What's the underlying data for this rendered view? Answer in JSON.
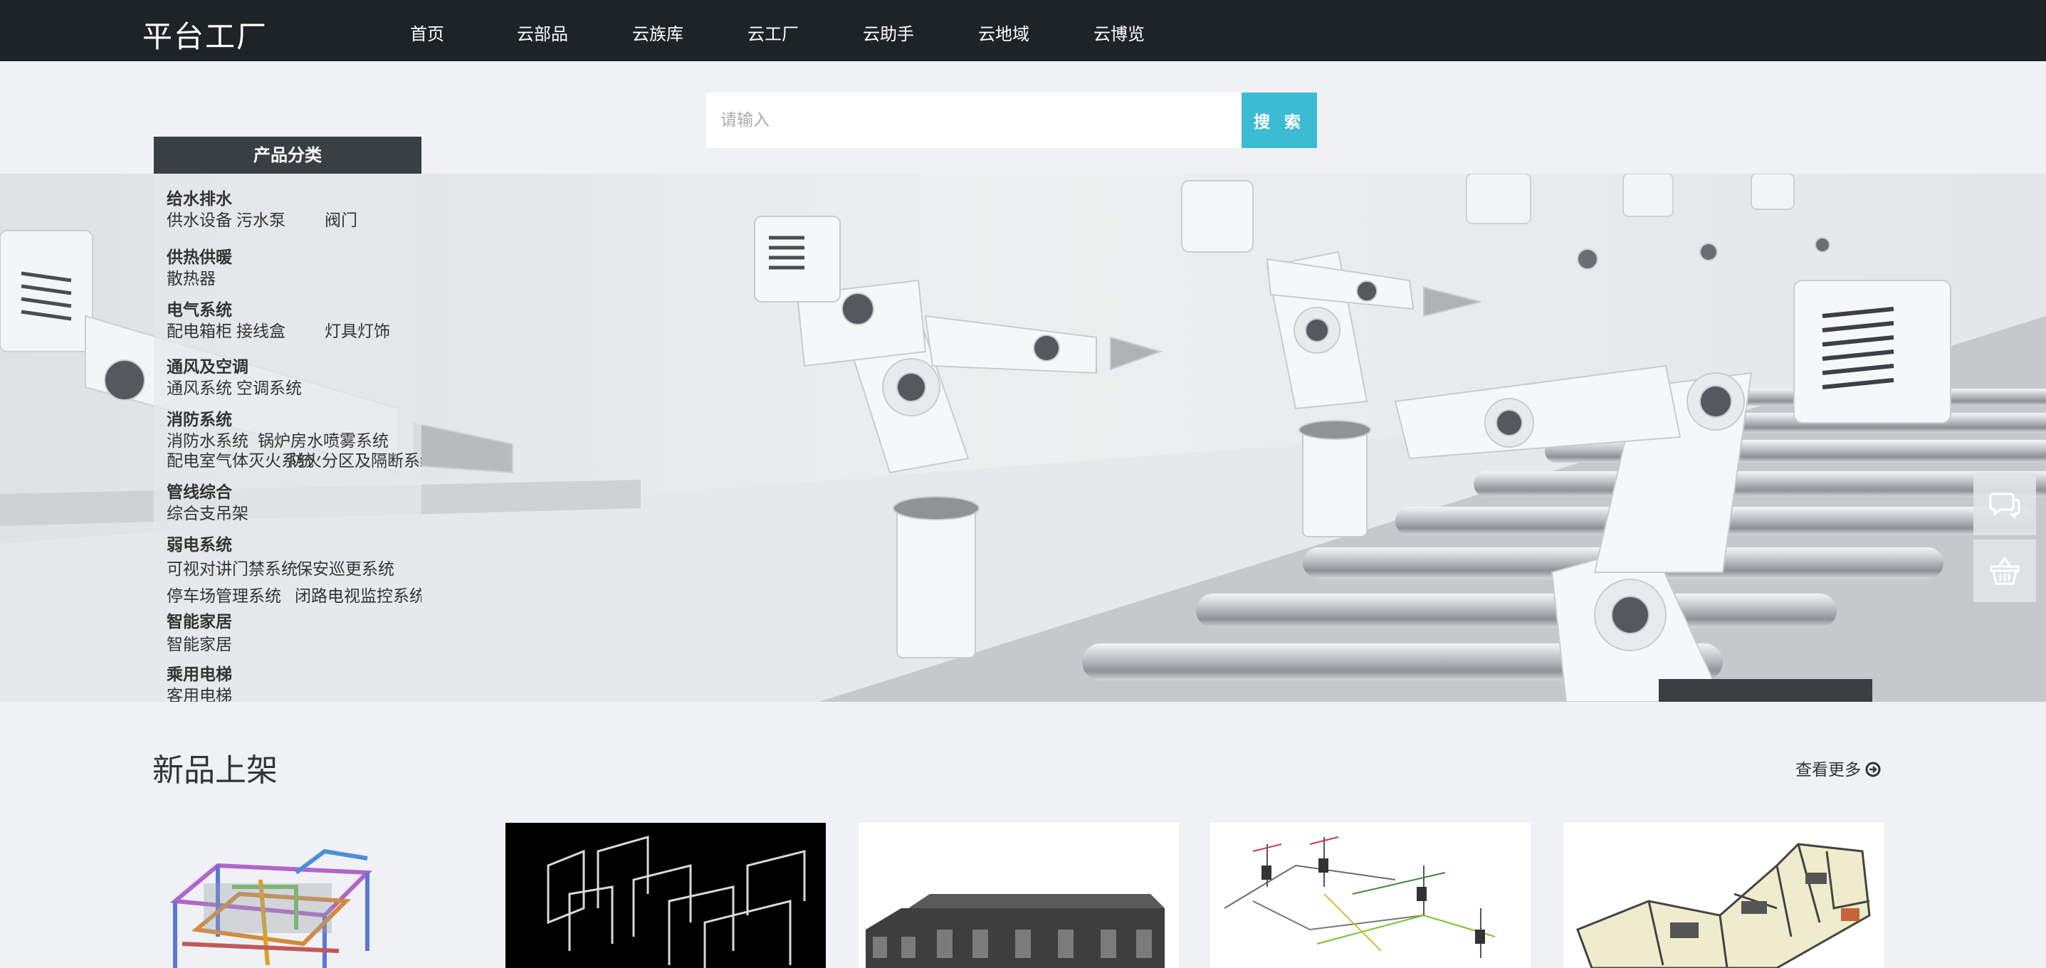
{
  "header": {
    "logo": "平台工厂",
    "nav": [
      "首页",
      "云部品",
      "云族库",
      "云工厂",
      "云助手",
      "云地域",
      "云博览"
    ]
  },
  "search": {
    "placeholder": "请输入",
    "button": "搜 索"
  },
  "categories": {
    "heading": "产品分类",
    "groups": [
      {
        "title": "给水排水",
        "items": [
          "供水设备",
          "污水泵",
          "阀门"
        ]
      },
      {
        "title": "供热供暖",
        "items": [
          "散热器"
        ]
      },
      {
        "title": "电气系统",
        "items": [
          "配电箱柜",
          "接线盒",
          "灯具灯饰"
        ]
      },
      {
        "title": "通风及空调",
        "items": [
          "通风系统",
          "空调系统"
        ]
      },
      {
        "title": "消防系统",
        "items": [
          "消防水系统",
          "锅炉房水喷雾系统",
          "配电室气体灭火系统",
          "防火分区及隔断系统"
        ]
      },
      {
        "title": "管线综合",
        "items": [
          "综合支吊架"
        ]
      },
      {
        "title": "弱电系统",
        "items": [
          "可视对讲门禁系统",
          "保安巡更系统",
          "停车场管理系统",
          "闭路电视监控系统"
        ]
      },
      {
        "title": "智能家居",
        "items": [
          "智能家居"
        ]
      },
      {
        "title": "乘用电梯",
        "items": [
          "客用电梯"
        ]
      }
    ]
  },
  "side_icons": [
    "chat-icon",
    "basket-icon"
  ],
  "new_products": {
    "title": "新品上架",
    "more": "查看更多"
  },
  "colors": {
    "nav_bg": "#1d2327",
    "accent": "#3cbcd3",
    "page_bg": "#eff1f5"
  }
}
